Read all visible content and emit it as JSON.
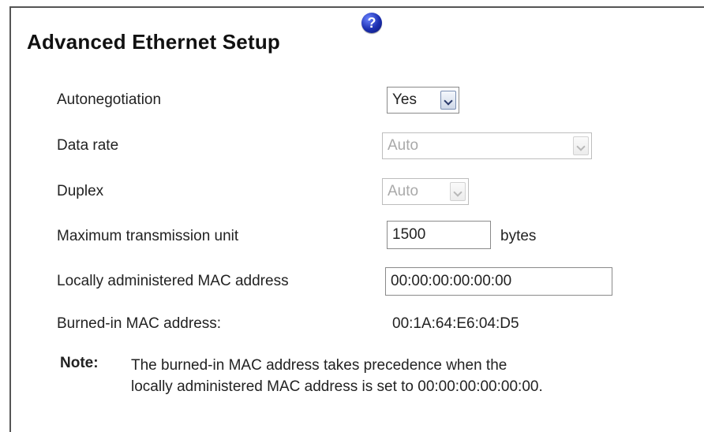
{
  "title": "Advanced Ethernet Setup",
  "help_icon_glyph": "?",
  "icons": {
    "help": "help-icon",
    "dropdown": "chevron-down-icon"
  },
  "fields": {
    "autonegotiation": {
      "label": "Autonegotiation",
      "value": "Yes",
      "enabled": true
    },
    "data_rate": {
      "label": "Data rate",
      "value": "Auto",
      "enabled": false
    },
    "duplex": {
      "label": "Duplex",
      "value": "Auto",
      "enabled": false
    },
    "mtu": {
      "label": "Maximum transmission unit",
      "value": "1500",
      "unit": "bytes"
    },
    "local_mac": {
      "label": "Locally administered MAC address",
      "value": "00:00:00:00:00:00"
    },
    "burned_mac": {
      "label": "Burned-in MAC address:",
      "value": "00:1A:64:E6:04:D5"
    }
  },
  "note": {
    "label": "Note:",
    "line1": "The burned-in MAC address takes precedence when the",
    "line2": "locally administered MAC address is set to 00:00:00:00:00:00."
  },
  "colors": {
    "help_icon": "#1b2fb0",
    "disabled_text": "#a9a9a9"
  }
}
